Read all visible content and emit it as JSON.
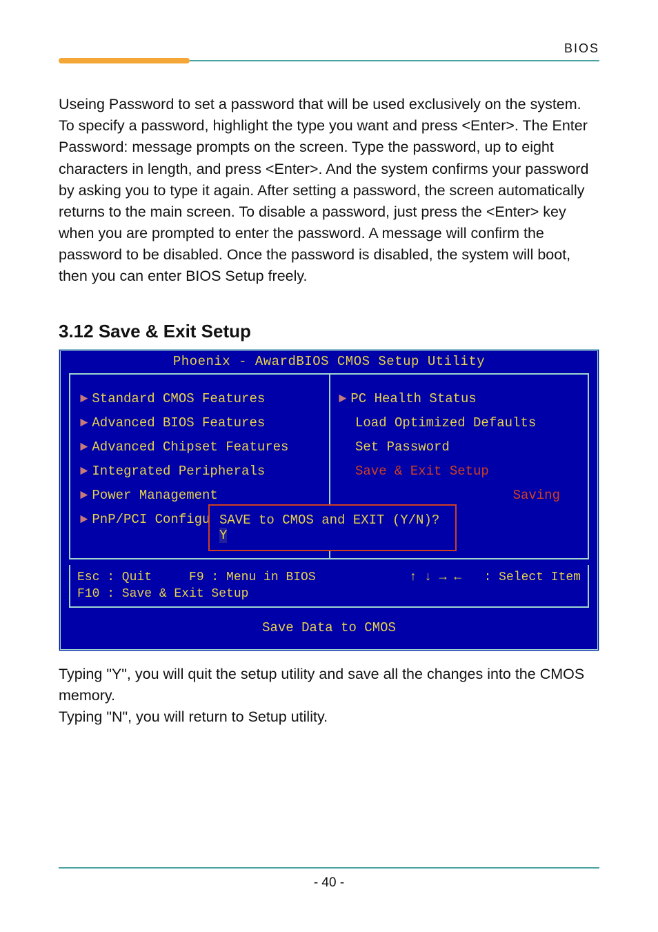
{
  "header": {
    "label": "BIOS"
  },
  "intro_paragraph": "Useing Password to set a password that will be used exclusively on the system. To specify a password, highlight the type you want and press <Enter>. The Enter Password: message prompts on the screen. Type the password, up to eight characters in length, and press <Enter>. And the system confirms your password by asking you to type it again. After setting a password, the screen automatically returns to the main screen. To disable a password, just press the <Enter> key when you are prompted to enter the password. A message will confirm the password to be disabled. Once the password is disabled, the system will boot, then you can enter BIOS Setup freely.",
  "section": {
    "heading": "3.12 Save & Exit Setup"
  },
  "bios": {
    "title": "Phoenix - AwardBIOS CMOS Setup Utility",
    "left_items": [
      {
        "label": "Standard CMOS Features",
        "marker": true
      },
      {
        "label": "Advanced BIOS Features",
        "marker": true
      },
      {
        "label": "Advanced Chipset Features",
        "marker": true
      },
      {
        "label": "Integrated Peripherals",
        "marker": true
      },
      {
        "label": "Power Management",
        "marker": true
      },
      {
        "label": "PnP/PCI Configura",
        "marker": true
      }
    ],
    "right_items": [
      {
        "label": "PC Health Status",
        "marker": true,
        "red": false
      },
      {
        "label": "Load Optimized Defaults",
        "marker": false,
        "red": false
      },
      {
        "label": "Set Password",
        "marker": false,
        "red": false
      },
      {
        "label": "Save & Exit Setup",
        "marker": false,
        "red": true
      },
      {
        "label": "Saving",
        "marker": false,
        "red": true,
        "rightalign": true
      }
    ],
    "dialog": {
      "prompt": "SAVE to CMOS and EXIT (Y/N)? ",
      "response": "Y"
    },
    "keys_left": "Esc : Quit     F9 : Menu in BIOS\nF10 : Save & Exit Setup",
    "keys_right": "↑ ↓ → ←   : Select Item",
    "footnote": "Save Data to CMOS"
  },
  "after": {
    "line1": "Typing \"Y\", you will quit the setup utility and save all the changes into the CMOS memory.",
    "line2": "Typing \"N\", you will return to Setup utility."
  },
  "footer": {
    "page": "- 40 -"
  }
}
